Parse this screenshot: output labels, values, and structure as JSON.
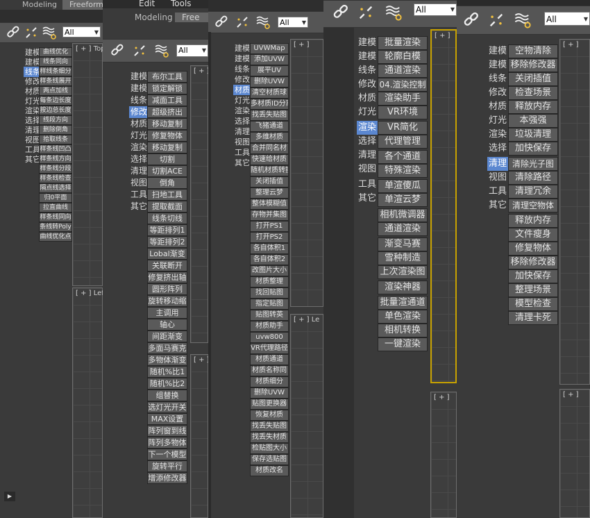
{
  "ribbon": {
    "tab_modeling": "Modeling",
    "tab_freeform": "Freeform",
    "tab_freeform_short": "Free",
    "menu_edit": "Edit",
    "menu_tools": "Tools"
  },
  "toolbar": {
    "filter_value": "All"
  },
  "viewports": {
    "top_label": "[ + ] Top",
    "left_label": "[ + ] Left",
    "short_label": "[ + ]",
    "short_label_le": "[ + ] Le",
    "short_label_lef": "[ + ] Lef"
  },
  "categories": [
    "建模",
    "建模",
    "线条",
    "修改",
    "材质",
    "灯光",
    "渲染",
    "选择",
    "清理",
    "视图",
    "工具",
    "其它"
  ],
  "panel1": {
    "buttons": [
      "曲线优化",
      "线条同向",
      "样线条细分",
      "样条线展开",
      "两点加线",
      "每条边长度",
      "按边总长度",
      "线段方向",
      "删除倒角",
      "拾取线条",
      "样条线凹凸",
      "样条线方向",
      "样条线分段",
      "样条线检查",
      "隔点线选择",
      "归0平面",
      "拉直曲线",
      "样条线同向",
      "条线转Poly",
      "曲线优化点"
    ]
  },
  "panel2": {
    "buttons": [
      "布尔工具",
      "锁定解锁",
      "减面工具",
      "超级挤出",
      "移动复制",
      "修复物体",
      "移动复制",
      "切割",
      "切割ACE",
      "倒角",
      "扫地工具",
      "提取截面",
      "线条切线",
      "等距排列1",
      "等距排列2",
      "Lobal渐变",
      "关联断开",
      "修复挤出轴",
      "圆形阵列",
      "旋转移动缩",
      "主调用",
      "轴心",
      "间距渐变",
      "多面马赛克",
      "多物体渐变",
      "随机%比1",
      "随机%比2",
      "组替换",
      "选灯光开关",
      "MAX设置",
      "阵列窗到线",
      "阵列多物体",
      "下一个模型",
      "旋转平行",
      "增添修改器"
    ]
  },
  "panel3": {
    "cats": [
      "建模",
      "建模",
      "线条",
      "修改",
      "材质",
      "灯光",
      "渲染",
      "选择",
      "清理",
      "视图",
      "工具",
      "其它"
    ],
    "buttons": [
      "UVWMap",
      "添加UVW",
      "展平UV",
      "删除UVW",
      "清空材质球",
      "多材质ID分离",
      "找丢失贴图",
      "飞猪通道",
      "多维材质",
      "合并同名材",
      "快速给材质",
      "随机材质转换",
      "关闭插值",
      "整理云梦",
      "整体模糊值",
      "存物并集图",
      "打开PS1",
      "打开PS2",
      "各自体积1",
      "各自体积2",
      "改图片大小",
      "材质整理",
      "找回贴图",
      "指定贴图",
      "贴图转英",
      "材质助手",
      "uvw800",
      "VR代理路径",
      "材质通道",
      "材质名称同",
      "材质细分",
      "删除UVW",
      "贴图更换器",
      "恢复材质",
      "找丢失贴图",
      "找丢失材质",
      "检贴图大小",
      "保存选贴图",
      "材质改名"
    ]
  },
  "panel4": {
    "cats": [
      "建模",
      "建模",
      "线条",
      "修改",
      "材质",
      "灯光",
      "渲染",
      "选择",
      "清理",
      "视图",
      "工具",
      "其它"
    ],
    "buttons": [
      "批量渲染",
      "轮廓白模",
      "通道渲染",
      "04.渲染控制",
      "渲染助手",
      "VR环境",
      "VR简化",
      "代理管理",
      "各个通道",
      "特殊渲染",
      "单渲傻瓜",
      "单渲云梦",
      "相机微调器",
      "通道渲染",
      "渐变马赛",
      "雪种制造",
      "上次渲染图",
      "渲染神器",
      "批量渲通道",
      "单色渲染",
      "相机转换",
      "一键渲染"
    ]
  },
  "panel5": {
    "cats": [
      "建模",
      "建模",
      "线条",
      "修改",
      "材质",
      "灯光",
      "渲染",
      "选择",
      "清理",
      "视图",
      "工具",
      "其它"
    ],
    "buttons": [
      "空物清除",
      "移除修改器",
      "关闭插值",
      "检查场景",
      "释放内存",
      "本强强",
      "垃圾清理",
      "加快保存",
      "清除光子图",
      "清除路径",
      "清理冗余",
      "清理空物体",
      "释放内存",
      "文件瘦身",
      "修复物体",
      "移除修改器",
      "加快保存",
      "整理场景",
      "模型检查",
      "清理卡死"
    ]
  }
}
